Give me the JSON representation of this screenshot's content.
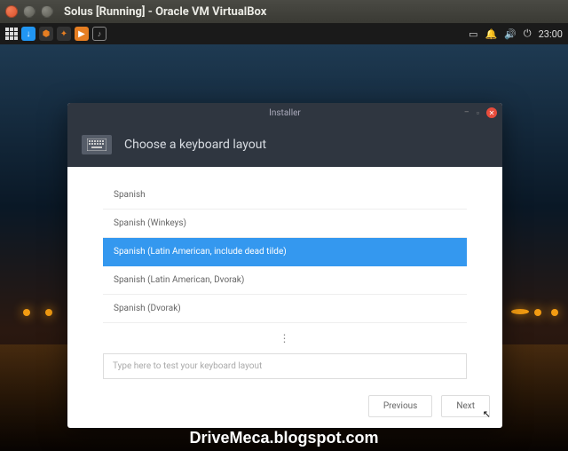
{
  "host": {
    "title": "Solus [Running] - Oracle VM VirtualBox"
  },
  "panel": {
    "time": "23:00"
  },
  "installer": {
    "window_title": "Installer",
    "heading": "Choose a keyboard layout",
    "layouts": [
      {
        "label": "Spanish",
        "selected": false
      },
      {
        "label": "Spanish (Winkeys)",
        "selected": false
      },
      {
        "label": "Spanish (Latin American, include dead tilde)",
        "selected": true
      },
      {
        "label": "Spanish (Latin American, Dvorak)",
        "selected": false
      },
      {
        "label": "Spanish (Dvorak)",
        "selected": false
      }
    ],
    "test_placeholder": "Type here to test your keyboard layout",
    "prev_label": "Previous",
    "next_label": "Next"
  },
  "watermark": "DriveMeca.blogspot.com"
}
